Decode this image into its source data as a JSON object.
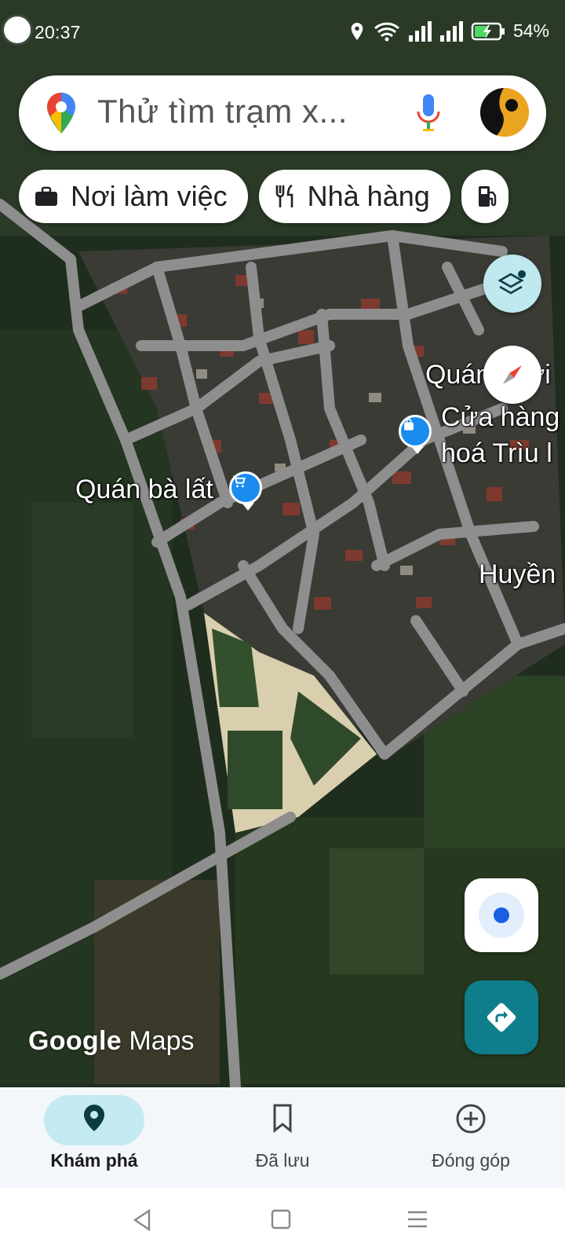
{
  "status_bar": {
    "time": "20:37",
    "battery": "54%"
  },
  "search": {
    "placeholder": "Thử tìm trạm x..."
  },
  "chips": [
    {
      "label": "Nơi làm việc",
      "icon": "briefcase-icon"
    },
    {
      "label": "Nhà hàng",
      "icon": "restaurant-icon"
    },
    {
      "label": "",
      "icon": "gas-station-icon"
    }
  ],
  "map": {
    "labels": {
      "quan_ba_lat": "Quán bà lất",
      "cua_hang_line1": "Cửa hàng",
      "cua_hang_line2": "hoá Trìu l",
      "quan_partial": "Quán",
      "quan_partial2": "ơi",
      "huyen_partial": "Huyền"
    },
    "watermark_google": "Google",
    "watermark_maps": "Maps"
  },
  "bottom_nav": {
    "items": [
      {
        "label": "Khám phá",
        "icon": "location-pin-icon",
        "active": true
      },
      {
        "label": "Đã lưu",
        "icon": "bookmark-icon",
        "active": false
      },
      {
        "label": "Đóng góp",
        "icon": "add-circle-icon",
        "active": false
      }
    ]
  },
  "colors": {
    "accent": "#0f7e8c",
    "active_pill": "#c3eaf0",
    "poi_blue": "#1a8cf0"
  }
}
